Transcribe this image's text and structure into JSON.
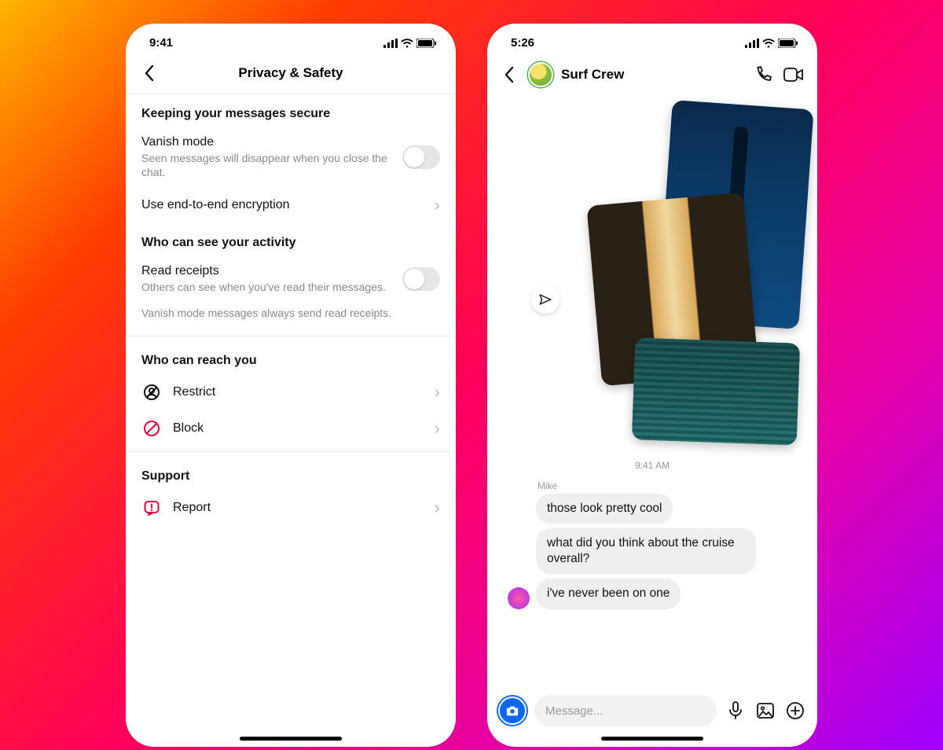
{
  "phone_left": {
    "status_time": "9:41",
    "header_title": "Privacy & Safety",
    "section1_title": "Keeping your messages secure",
    "vanish": {
      "label": "Vanish mode",
      "sub": "Seen messages will disappear when you close the chat.",
      "enabled": false
    },
    "e2e": {
      "label": "Use end-to-end encryption"
    },
    "section2_title": "Who can see your activity",
    "receipts": {
      "label": "Read receipts",
      "sub": "Others can see when you've read their messages.",
      "enabled": false
    },
    "receipts_note": "Vanish mode messages always send read receipts.",
    "section3_title": "Who can reach you",
    "restrict": {
      "label": "Restrict"
    },
    "block": {
      "label": "Block"
    },
    "section4_title": "Support",
    "report": {
      "label": "Report"
    }
  },
  "phone_right": {
    "status_time": "5:26",
    "chat_title": "Surf Crew",
    "timestamp": "9:41 AM",
    "sender": "Mike",
    "messages": [
      "those look pretty cool",
      "what did you think about the cruise overall?",
      "i've never been on one"
    ],
    "composer_placeholder": "Message..."
  },
  "colors": {
    "danger": "#e00040",
    "accent_blue": "#0a66ff"
  }
}
